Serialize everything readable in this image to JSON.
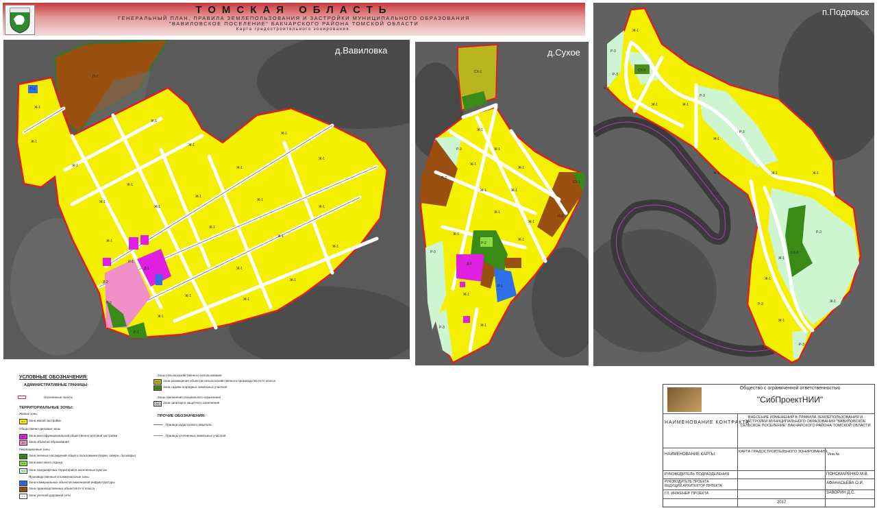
{
  "header": {
    "title": "ТОМСКАЯ ОБЛАСТЬ",
    "line1": "ГЕНЕРАЛЬНЫЙ ПЛАН, ПРАВИЛА ЗЕМЛЕПОЛЬЗОВАНИЯ И ЗАСТРОЙКИ МУНИЦИПАЛЬНОГО ОБРАЗОВАНИЯ",
    "line2": "\"ВАВИЛОВСКОЕ ПОСЕЛЕНИЕ\" БАКЧАРСКОГО РАЙОНА ТОМСКОЙ ОБЛАСТИ",
    "line3": "Карта градостроительного зонирования."
  },
  "panels": {
    "vavilovka": {
      "title": "д.Вавиловка",
      "labels": {
        "p2": "П-2",
        "p1": "П-1",
        "ps": "Р-4",
        "d2": "Д-2",
        "d1": "Д-1",
        "i1": "И-1",
        "r1": "Р-1",
        "r2": "Р-2",
        "j": "Ж-1"
      }
    },
    "suhoe": {
      "title": "д.Сухое",
      "labels": {
        "sh1": "СХ-1",
        "p2": "П-2",
        "p3": "Р-3",
        "d1": "Д-1",
        "r1": "Р-1",
        "j": "Ж-1",
        "r2": "Р-2"
      }
    },
    "podolsk": {
      "title": "п.Подольск",
      "labels": {
        "sh2": "СХ-2",
        "r3": "Р-3",
        "j": "Ж-1"
      }
    }
  },
  "legend": {
    "title": "УСЛОВНЫЕ ОБОЗНАЧЕНИЯ:",
    "admin": "АДМИНИСТРАТИВНЫЕ ГРАНИЦЫ:",
    "settlements": "Населенные пункты",
    "territorial": "ТЕРРИТОРИАЛЬНЫЕ ЗОНЫ:",
    "residential": "Жилые зоны",
    "zh1": "Зона жилой застройки",
    "public_business": "Общественно-деловые зоны",
    "d1": "Зона многофункциональной общественно-деловой застройки",
    "d2": "Зона объектов образования",
    "recreational": "Рекреационные зоны",
    "r1": "Зона зеленых насаждений общего пользования (парки, скверы, бульвары)",
    "r2": "Зона массового отдыха",
    "r3": "Зона ландшафтных территорий в населенных пунктах",
    "production": "Производственные и коммунальные зоны",
    "i1": "Зона коммунальных объектов инженерной инфраструктуры",
    "p1": "Зона производственных объектов IV-V класса",
    "t1": "Зона уличной дорожной сети",
    "agri_head": "Зоны сельскохозяйственного использования",
    "sh1": "Зона размещения объектов сельскохозяйственного производства III-IV класса",
    "sh2": "Зона садово-огородных земельных участков",
    "special_head": "Зоны озеленения специального назначения",
    "sp": "Зона санитарно-защитного озеленения",
    "other_head": "ПРОЧИЕ ОБОЗНАЧЕНИЯ:",
    "other1": "Граница кадастрового квартала",
    "other2": "Границы уточненных земельных участков",
    "codes": {
      "zh1": "Ж-1",
      "d1": "Д-1",
      "d2": "Д-2",
      "r1": "Р-1",
      "r2": "Р-2",
      "r3": "Р-3",
      "i1": "И-1",
      "p1": "П-1",
      "t1": "Т-1",
      "sh1": "СХ-1",
      "sh2": "СХ-2",
      "sp": "Р-4"
    }
  },
  "stamp": {
    "company": "Общество с ограниченной ответственностью",
    "name": "\"СибПроектНИИ\"",
    "contract_label": "НАИМЕНОВАНИЕ КОНТРАКТА",
    "contract_text": "ВНЕСЕНИЕ ИЗМЕНЕНИЙ В ПРАВИЛА ЗЕМЛЕПОЛЬЗОВАНИЯ И ЗАСТРОЙКИ МУНИЦИПАЛЬНОГО ОБРАЗОВАНИЯ \"ВАВИЛОВСКОЕ СЕЛЬСКОЕ ПОСЕЛЕНИЕ\" БАКЧАРСКОГО РАЙОНА ТОМСКОЙ ОБЛАСТИ",
    "map_label": "НАИМЕНОВАНИЕ КАРТЫ:",
    "map_text": "КАРТА ГРАДОСТРОИТЕЛЬНОГО ЗОНИРОВАНИЯ.",
    "inv": "Инв.№",
    "role1": "РУКОВОДИТЕЛЬ ПОДРАЗДЕЛЕНИЯ",
    "person1": "ПОНОМАРЕНКО М.В.",
    "role2": "РУКОВОДИТЕЛЬ ПРОЕКТА ВЕДУЩИЙ АРХИТЕКТОР ПРОЕКТА",
    "person2": "АФАНАСЬЕВА О.И.",
    "role3": "ГЛ. ИНЖЕНЕР ПРОЕКТА",
    "person3": "ЗАВОРИН Д.С.",
    "year": "2017"
  },
  "colors": {
    "zh": "#f5f000",
    "boundary": "#d82020",
    "p2": "#9a5010",
    "d1": "#e020e0",
    "d2": "#f090c8",
    "r1": "#3a8a18",
    "r2": "#88dd44",
    "r3": "#cdf5d2",
    "i1": "#2f6fe8",
    "sh1": "#b8b520",
    "sh2": "#4f8a1c",
    "photo": "#5e5e5e"
  }
}
